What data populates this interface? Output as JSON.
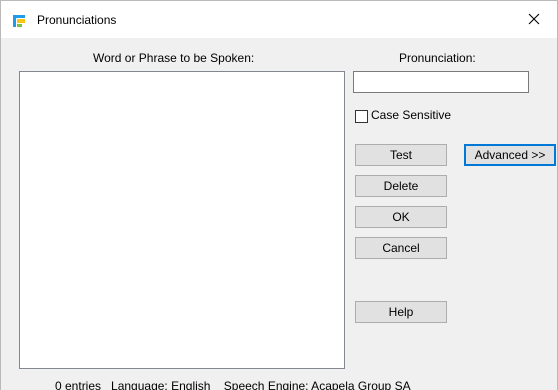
{
  "window": {
    "title": "Pronunciations",
    "close_glyph": "✕"
  },
  "labels": {
    "word_phrase": "Word or Phrase to be Spoken:",
    "pronunciation": "Pronunciation:"
  },
  "pronunciation_input": {
    "value": ""
  },
  "case_sensitive": {
    "label": "Case Sensitive",
    "checked": false
  },
  "buttons": {
    "test": "Test",
    "advanced": "Advanced >>",
    "delete": "Delete",
    "ok": "OK",
    "cancel": "Cancel",
    "help": "Help"
  },
  "status_bar": {
    "text": "0 entries   Language: English    Speech Engine: Acapela Group SA"
  },
  "colors": {
    "accent": "#0078d7",
    "icon_blue": "#1e9be9",
    "icon_yellow": "#f5c518",
    "icon_green": "#7cc242"
  }
}
